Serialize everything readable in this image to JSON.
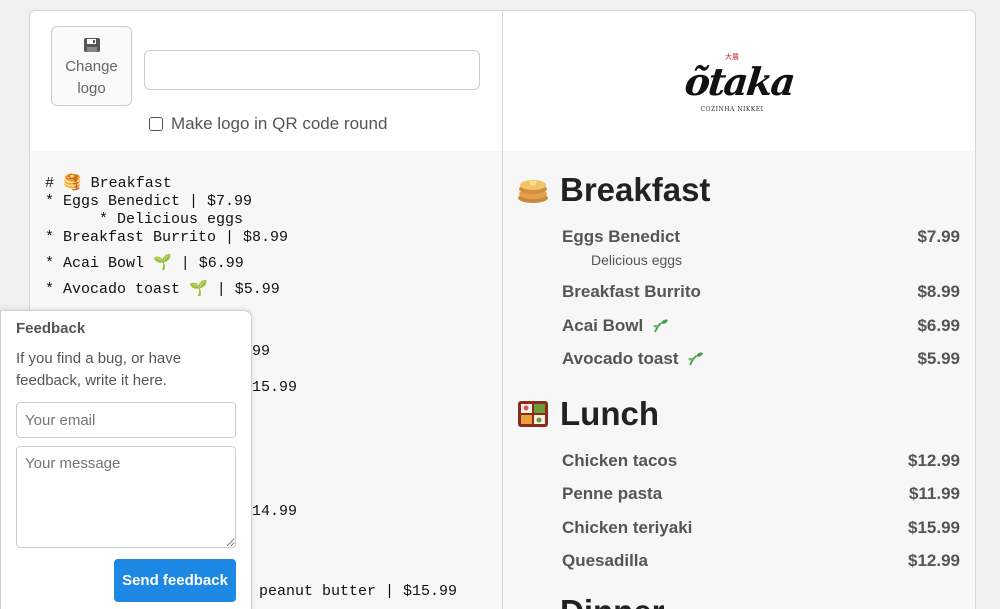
{
  "logo_panel": {
    "change_logo_label_1": "Change",
    "change_logo_label_2": "logo",
    "logo_url_value": "",
    "round_logo_label": "Make logo in QR code round",
    "round_logo_checked": false
  },
  "brand": {
    "mark": "大農",
    "name": "õtaka",
    "subtitle": "COZINHA NIKKEI"
  },
  "editor": {
    "lines": [
      "# 🥞 Breakfast",
      "* Eggs Benedict | $7.99",
      "      * Delicious eggs",
      "* Breakfast Burrito | $8.99",
      "* Acai Bowl 🌱 | $6.99",
      "* Avocado toast 🌱 | $5.99",
      "99",
      "15.99",
      "14.99",
      "peanut butter | $15.99"
    ]
  },
  "menu": {
    "sections": [
      {
        "icon": "pancakes-icon",
        "title": "Breakfast",
        "items": [
          {
            "name": "Eggs Benedict",
            "price": "$7.99",
            "desc": "Delicious eggs",
            "vegan": false
          },
          {
            "name": "Breakfast Burrito",
            "price": "$8.99",
            "desc": "",
            "vegan": false
          },
          {
            "name": "Acai Bowl",
            "price": "$6.99",
            "desc": "",
            "vegan": true
          },
          {
            "name": "Avocado toast",
            "price": "$5.99",
            "desc": "",
            "vegan": true
          }
        ]
      },
      {
        "icon": "bento-box-icon",
        "title": "Lunch",
        "items": [
          {
            "name": "Chicken tacos",
            "price": "$12.99"
          },
          {
            "name": "Penne pasta",
            "price": "$11.99"
          },
          {
            "name": "Chicken teriyaki",
            "price": "$15.99"
          },
          {
            "name": "Quesadilla",
            "price": "$12.99"
          }
        ]
      },
      {
        "title": "Dinner"
      }
    ]
  },
  "feedback": {
    "title": "Feedback",
    "text": "If you find a bug, or have feedback, write it here.",
    "email_placeholder": "Your email",
    "message_placeholder": "Your message",
    "send_label": "Send feedback"
  },
  "colors": {
    "primary": "#1e88e5",
    "sprout": "#43a047"
  }
}
